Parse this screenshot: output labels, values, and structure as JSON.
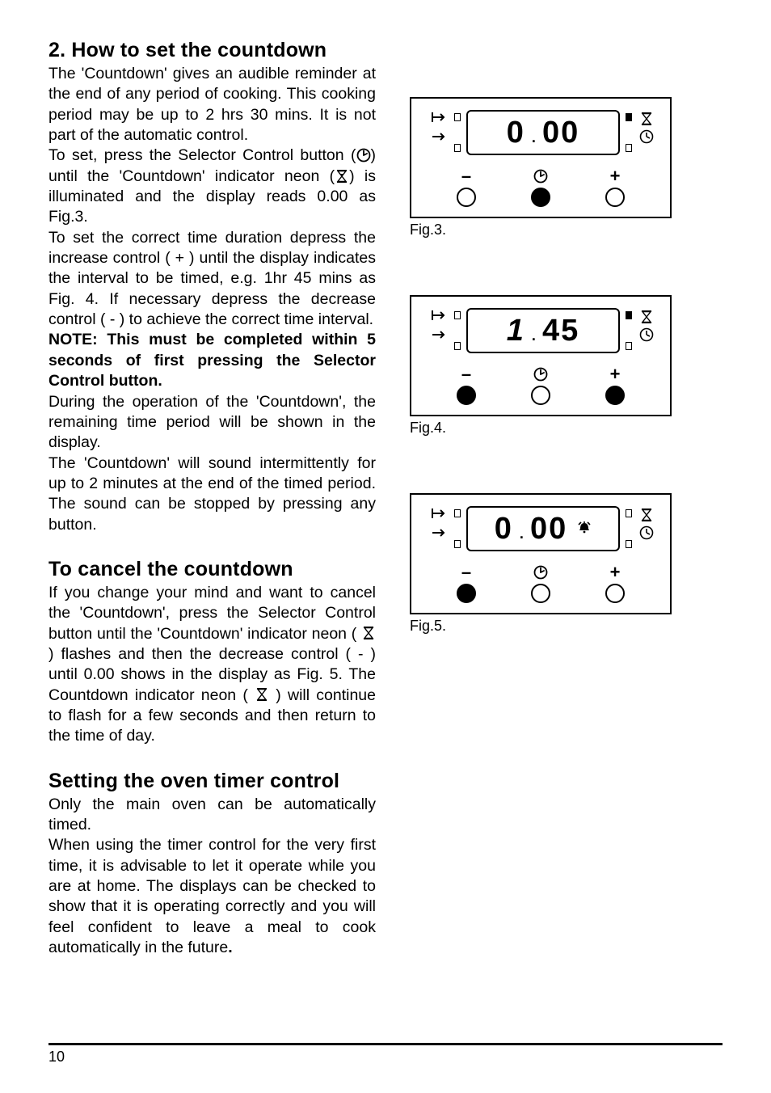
{
  "section1": {
    "title": "2.   How to set the countdown",
    "p1": "The 'Countdown' gives an audible reminder at the end of any period of cooking. This cooking period may be up to 2 hrs 30 mins. It is not part of the automatic control.",
    "p2a": "To set, press the Selector Control button (",
    "p2b": ") until the 'Countdown'  indicator neon (",
    "p2c": ") is illuminated and the display reads 0.00 as Fig.3.",
    "p3": "To set the correct time duration depress the increase control ( + ) until the display indicates the interval to be timed, e.g. 1hr 45 mins as Fig. 4.  If necessary depress the decrease control ( - ) to achieve the correct time interval.",
    "note": "NOTE:  This must be completed within 5 seconds of first pressing the Selector Control button.",
    "p4": "During the operation of the 'Countdown', the remaining time period will be shown in the display.",
    "p5": "The 'Countdown' will sound intermittently for up to 2 minutes at the end of the timed period. The sound can be stopped by pressing any button."
  },
  "section2": {
    "title": "To cancel the countdown",
    "p1a": "If you change your mind and want to cancel the 'Countdown', press the Selector Control button until the 'Countdown' indicator neon ( ",
    "p1b": " ) flashes and then the decrease control ( - ) until 0.00 shows in the display as Fig. 5.  The Countdown indicator neon ( ",
    "p1c": " ) will continue to flash for a few seconds and then return to the time of day."
  },
  "section3": {
    "title": "Setting the oven timer control",
    "p1": "Only the main oven can be automatically timed.",
    "p2a": "When using the timer control for the very first time, it is advisable to let it operate while you are at home.  The displays can be checked to show that it is operating correctly and you will feel confident to leave a meal to cook automatically in the future",
    "p2b": "."
  },
  "figures": {
    "fig3": {
      "label": "Fig.3.",
      "display_left": "0",
      "display_right": "00",
      "buttons": {
        "minus": "empty",
        "selector": "filled",
        "plus": "empty"
      },
      "indicator_right_filled": true
    },
    "fig4": {
      "label": "Fig.4.",
      "display_left": "1",
      "display_right": "45",
      "buttons": {
        "minus": "filled",
        "selector": "empty",
        "plus": "filled"
      },
      "indicator_right_filled": true
    },
    "fig5": {
      "label": "Fig.5.",
      "display_left": "0",
      "display_right": "00",
      "buttons": {
        "minus": "filled",
        "selector": "empty",
        "plus": "empty"
      },
      "indicator_right_filled": true,
      "bell_strike": true
    }
  },
  "symbols": {
    "minus": "–",
    "plus": "+"
  },
  "page_number": "10"
}
